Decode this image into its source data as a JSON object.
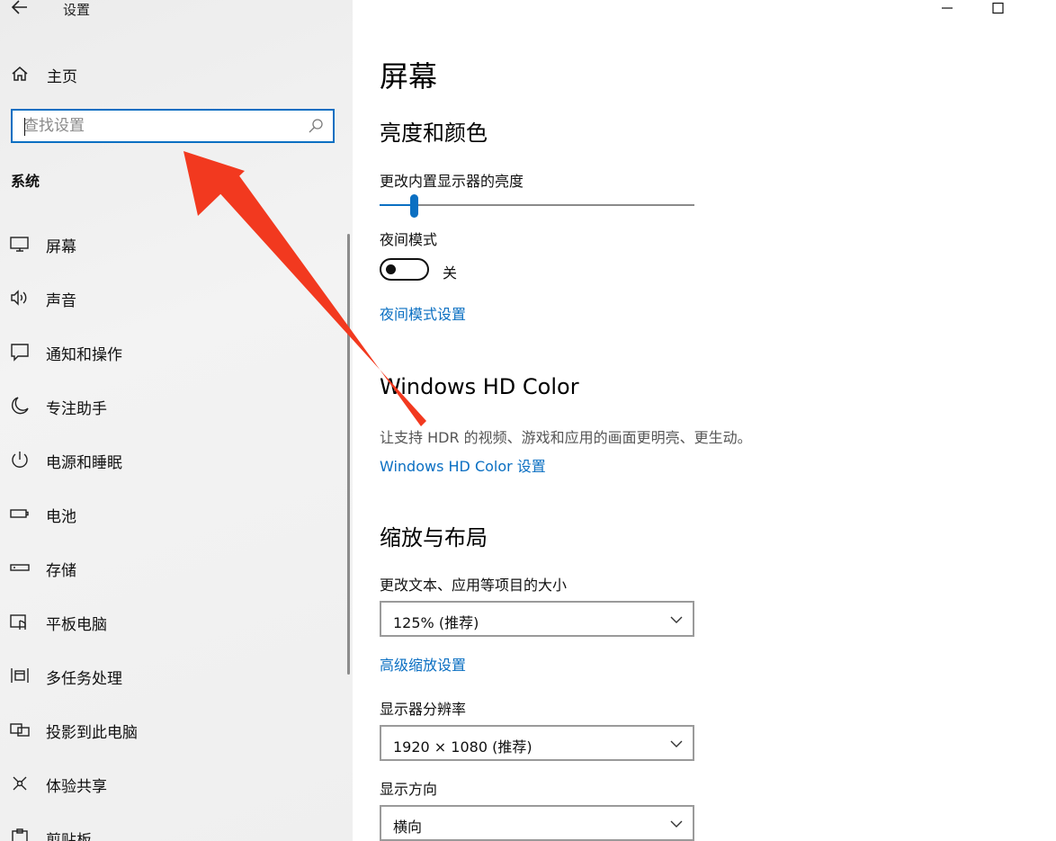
{
  "window": {
    "title": "设置",
    "controls": {
      "minimize": "minimize-icon",
      "maximize": "maximize-icon"
    }
  },
  "sidebar": {
    "home_label": "主页",
    "search": {
      "placeholder": "查找设置"
    },
    "section_label": "系统",
    "items": [
      {
        "label": "屏幕",
        "icon": "monitor-icon"
      },
      {
        "label": "声音",
        "icon": "speaker-icon"
      },
      {
        "label": "通知和操作",
        "icon": "notification-icon"
      },
      {
        "label": "专注助手",
        "icon": "moon-icon"
      },
      {
        "label": "电源和睡眠",
        "icon": "power-icon"
      },
      {
        "label": "电池",
        "icon": "battery-icon"
      },
      {
        "label": "存储",
        "icon": "storage-icon"
      },
      {
        "label": "平板电脑",
        "icon": "tablet-icon"
      },
      {
        "label": "多任务处理",
        "icon": "multitask-icon"
      },
      {
        "label": "投影到此电脑",
        "icon": "project-icon"
      },
      {
        "label": "体验共享",
        "icon": "share-icon"
      },
      {
        "label": "剪贴板",
        "icon": "clipboard-icon"
      }
    ]
  },
  "main": {
    "page_title": "屏幕",
    "brightness_color": {
      "heading": "亮度和颜色",
      "brightness_label": "更改内置显示器的亮度",
      "brightness_level": 0.11,
      "night_mode_label": "夜间模式",
      "night_mode_state": "关",
      "night_mode_settings_link": "夜间模式设置"
    },
    "hd_color": {
      "heading": "Windows HD Color",
      "description": "让支持 HDR 的视频、游戏和应用的画面更明亮、更生动。",
      "settings_link": "Windows HD Color 设置"
    },
    "scale_layout": {
      "heading": "缩放与布局",
      "scale_label": "更改文本、应用等项目的大小",
      "scale_value": "125% (推荐)",
      "advanced_scale_link": "高级缩放设置",
      "resolution_label": "显示器分辨率",
      "resolution_value": "1920 × 1080 (推荐)",
      "orientation_label": "显示方向",
      "orientation_value": "横向"
    }
  },
  "colors": {
    "accent": "#0a6fc2",
    "annotation_arrow": "#f2391f"
  }
}
